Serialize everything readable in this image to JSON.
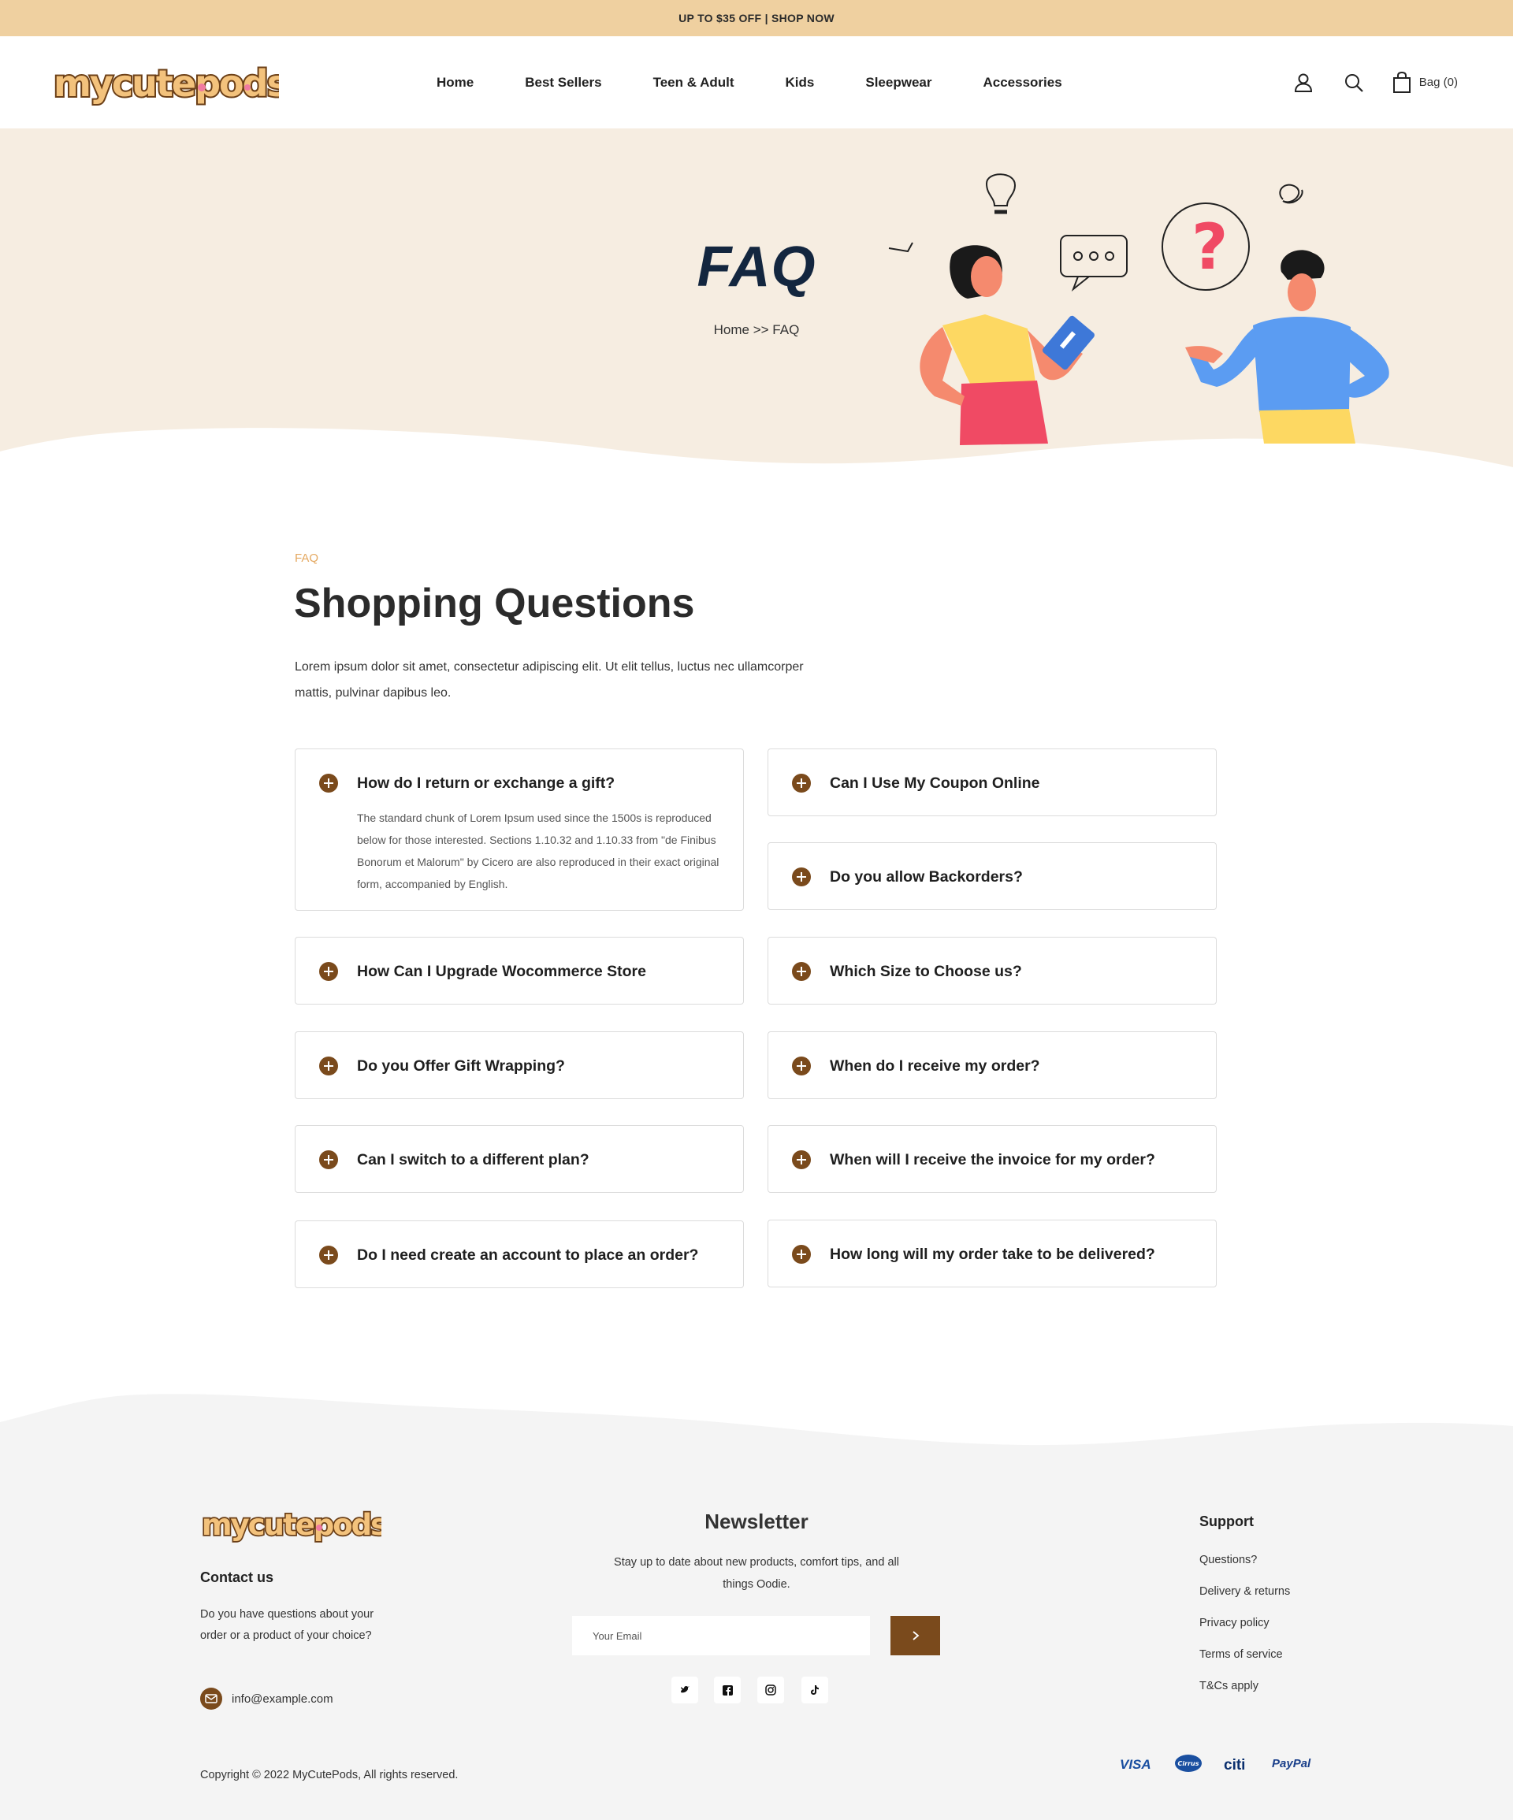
{
  "announcement": "UP TO $35 OFF | SHOP NOW",
  "brand": {
    "name": "mycutepods",
    "color": "#7a4a1c",
    "accent": "#e4a860"
  },
  "nav": {
    "items": [
      {
        "label": "Home"
      },
      {
        "label": "Best Sellers"
      },
      {
        "label": "Teen & Adult"
      },
      {
        "label": "Kids"
      },
      {
        "label": "Sleepwear"
      },
      {
        "label": "Accessories"
      }
    ]
  },
  "header_icons": {
    "account": "user-icon",
    "search": "search-icon",
    "bag_icon": "bag-icon",
    "bag_label": "Bag (0)"
  },
  "hero": {
    "title": "FAQ",
    "breadcrumb": "Home >> FAQ",
    "background": "#f6ede1"
  },
  "faq": {
    "kicker": "FAQ",
    "title": "Shopping Questions",
    "description": "Lorem ipsum dolor sit amet, consectetur adipiscing elit. Ut elit tellus, luctus nec ullamcorper mattis, pulvinar dapibus leo.",
    "left": [
      {
        "question": "How do I return or exchange a gift?",
        "answer": "The standard chunk of Lorem Ipsum used since the 1500s is reproduced below for those interested. Sections 1.10.32 and 1.10.33 from \"de Finibus Bonorum et Malorum\" by Cicero are also reproduced in their exact original form, accompanied by English.",
        "expanded": true
      },
      {
        "question": "How Can I Upgrade Wocommerce Store"
      },
      {
        "question": "Do you Offer Gift Wrapping?"
      },
      {
        "question": "Can I switch to a different plan?"
      },
      {
        "question": "Do I need create an account to place an order?"
      }
    ],
    "right": [
      {
        "question": "Can I Use My Coupon Online"
      },
      {
        "question": "Do you allow Backorders?"
      },
      {
        "question": "Which Size to Choose us?"
      },
      {
        "question": "When do I receive my order?"
      },
      {
        "question": "When will I receive the invoice for my order?"
      },
      {
        "question": "How long will my order take to be delivered?"
      }
    ]
  },
  "footer": {
    "contact_title": "Contact us",
    "contact_text": "Do you have questions about your order or a product of your choice?",
    "email": "info@example.com",
    "newsletter_title": "Newsletter",
    "newsletter_text": "Stay up to date about new products, comfort tips, and all things Oodie.",
    "email_placeholder": "Your Email",
    "social": [
      "twitter-icon",
      "facebook-icon",
      "instagram-icon",
      "tiktok-icon"
    ],
    "support_title": "Support",
    "support_links": [
      "Questions?",
      "Delivery & returns",
      "Privacy policy",
      "Terms of service",
      "T&Cs apply"
    ],
    "copyright": "Copyright © 2022 MyCutePods, All rights reserved.",
    "payments": [
      "VISA",
      "Cirrus",
      "citi",
      "PayPal"
    ]
  }
}
